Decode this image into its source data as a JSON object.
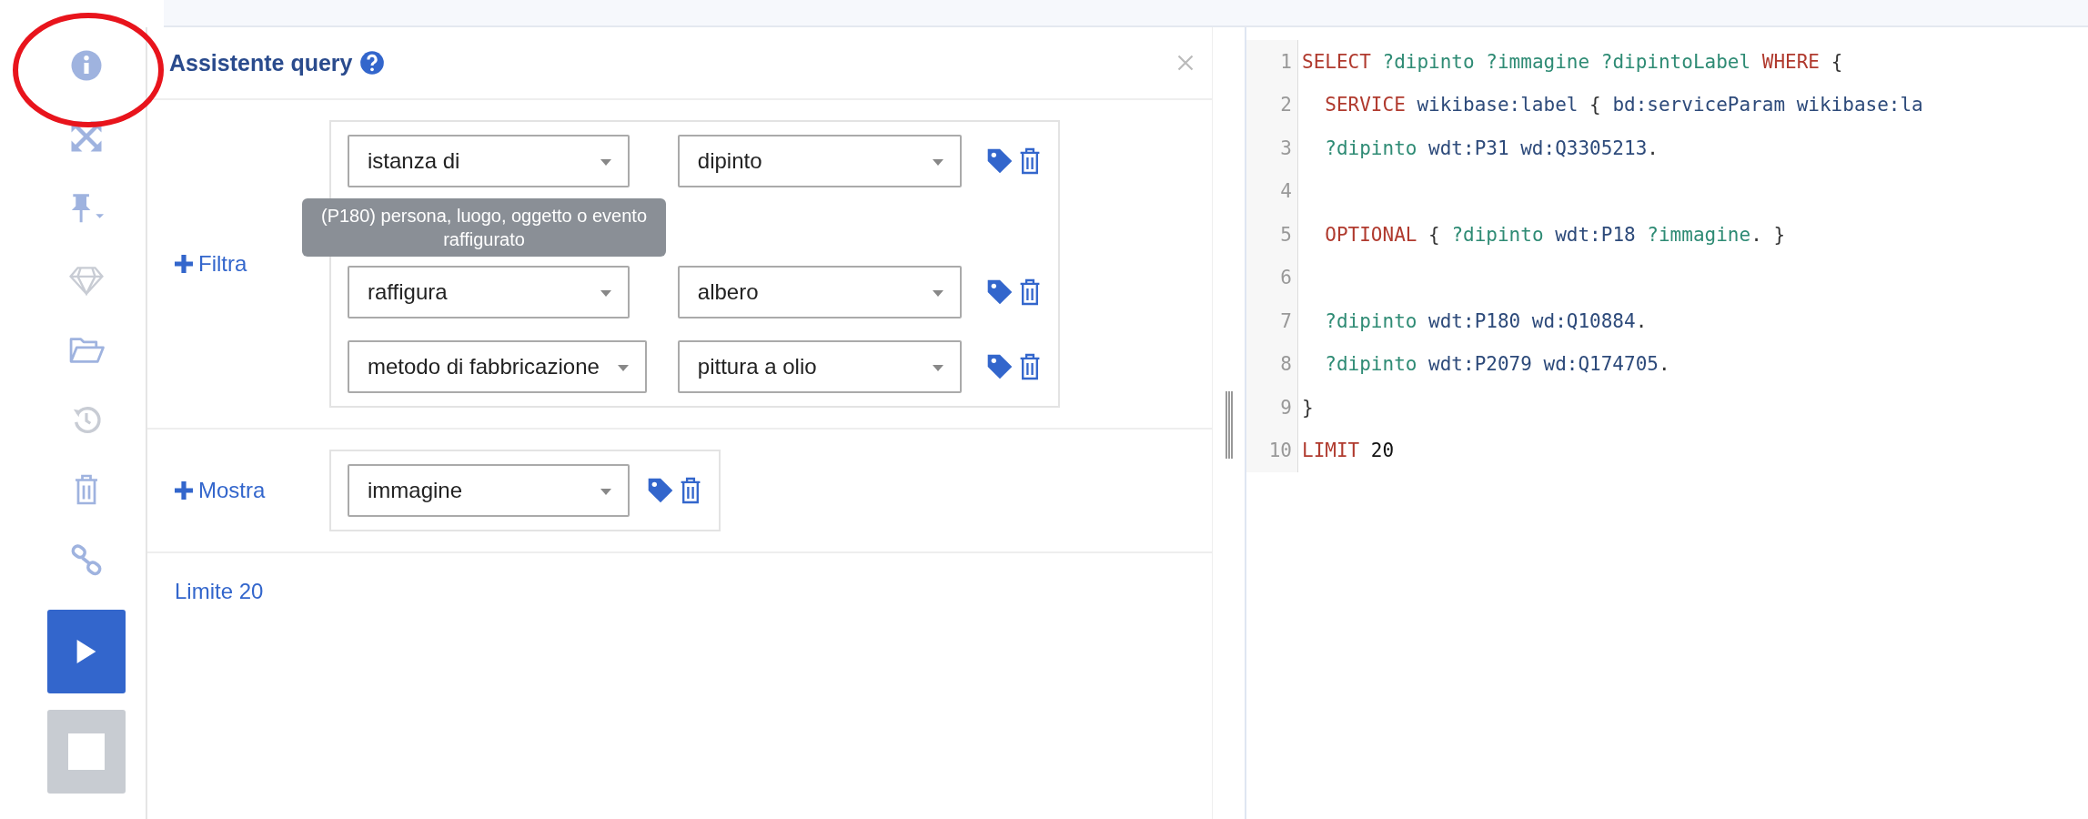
{
  "toolbar": {
    "run": {
      "disabled": false
    },
    "stop": {
      "disabled": true
    }
  },
  "panel": {
    "title": "Assistente query",
    "filter": {
      "label": "Filtra",
      "rows": [
        {
          "property": "istanza di",
          "value": "dipinto"
        },
        {
          "property": "raffigura",
          "value": "albero",
          "tooltip": "(P180) persona, luogo, oggetto o evento raffigurato"
        },
        {
          "property": "metodo di fabbricazione",
          "value": "pittura a olio"
        }
      ]
    },
    "show": {
      "label": "Mostra",
      "rows": [
        {
          "property": "immagine"
        }
      ]
    },
    "limit": "Limite 20"
  },
  "editor": {
    "lines": [
      {
        "number": "1",
        "tokens": [
          {
            "kind": "keyword",
            "text": "SELECT "
          },
          {
            "kind": "var",
            "text": "?dipinto "
          },
          {
            "kind": "var",
            "text": "?immagine "
          },
          {
            "kind": "var",
            "text": "?dipintoLabel "
          },
          {
            "kind": "keyword",
            "text": "WHERE "
          },
          {
            "kind": "plain",
            "text": "{"
          }
        ]
      },
      {
        "number": "2",
        "tokens": [
          {
            "kind": "keyword",
            "text": "  SERVICE"
          },
          {
            "kind": "name",
            "text": " wikibase:label "
          },
          {
            "kind": "plain",
            "text": "{"
          },
          {
            "kind": "name",
            "text": " bd:serviceParam wikibase:la"
          }
        ]
      },
      {
        "number": "3",
        "tokens": [
          {
            "kind": "var",
            "text": "  ?dipinto"
          },
          {
            "kind": "name",
            "text": " wdt:P31 wd:Q3305213"
          },
          {
            "kind": "plain",
            "text": "."
          }
        ]
      },
      {
        "number": "4"
      },
      {
        "number": "5",
        "tokens": [
          {
            "kind": "keyword",
            "text": "  OPTIONAL"
          },
          {
            "kind": "plain",
            "text": " { "
          },
          {
            "kind": "var",
            "text": "?dipinto"
          },
          {
            "kind": "name",
            "text": " wdt:P18 "
          },
          {
            "kind": "var",
            "text": "?immagine"
          },
          {
            "kind": "plain",
            "text": ". }"
          }
        ]
      },
      {
        "number": "6"
      },
      {
        "number": "7",
        "tokens": [
          {
            "kind": "var",
            "text": "  ?dipinto"
          },
          {
            "kind": "name",
            "text": " wdt:P180 wd:Q10884"
          },
          {
            "kind": "plain",
            "text": "."
          }
        ]
      },
      {
        "number": "8",
        "tokens": [
          {
            "kind": "var",
            "text": "  ?dipinto"
          },
          {
            "kind": "name",
            "text": " wdt:P2079 wd:Q174705"
          },
          {
            "kind": "plain",
            "text": "."
          }
        ]
      },
      {
        "number": "9",
        "tokens": [
          {
            "kind": "plain",
            "text": "}"
          }
        ]
      },
      {
        "number": "10",
        "tokens": [
          {
            "kind": "keyword",
            "text": "LIMIT "
          },
          {
            "kind": "number",
            "text": "20"
          }
        ]
      }
    ]
  }
}
